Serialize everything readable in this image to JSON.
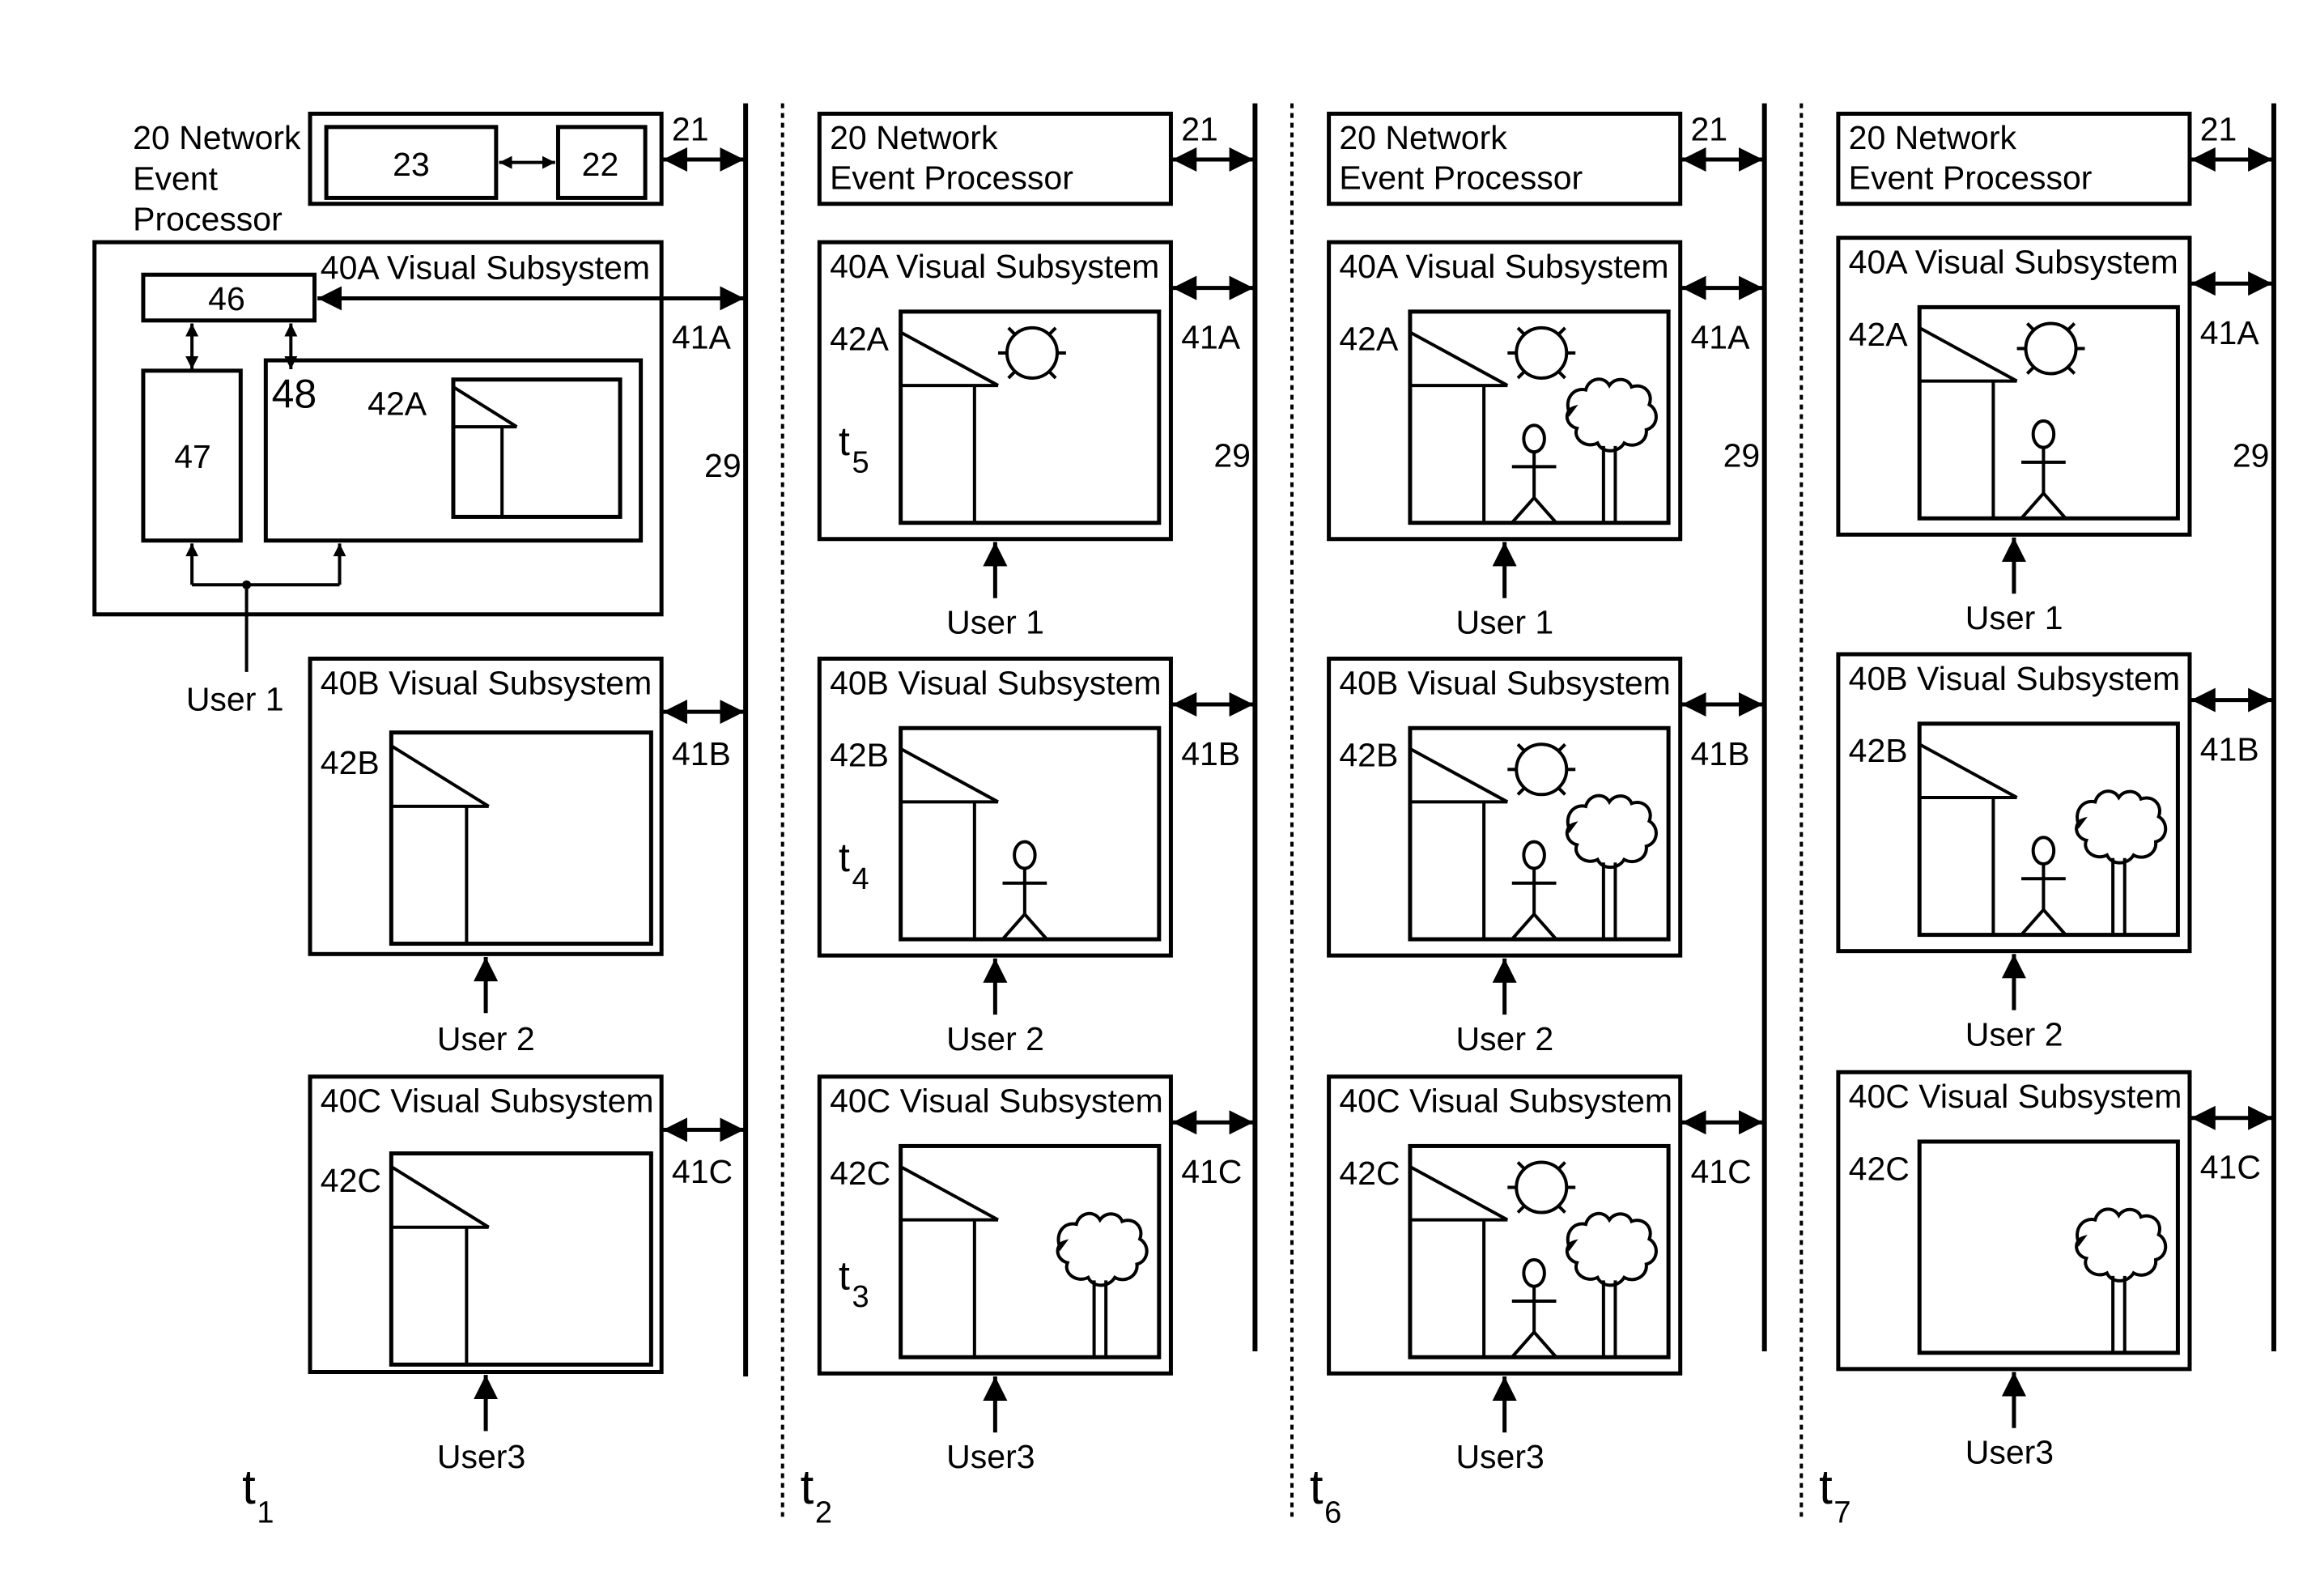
{
  "figure": {
    "colors": {
      "ink": "#000000",
      "paper": "#ffffff"
    },
    "bus_label": "29",
    "nep_link_label": "21",
    "panel1": {
      "time_label": "t",
      "time_sub": "1",
      "nep_title_lines": [
        "20 Network",
        "Event",
        "Processor"
      ],
      "nep_blocks": [
        "23",
        "22"
      ],
      "subsystem_a": {
        "title": "40A Visual Subsystem",
        "link": "41A",
        "block_46": "46",
        "block_47": "47",
        "block_48": "48",
        "screen_label": "42A",
        "user": "User 1"
      }
    },
    "panels": [
      {
        "id": "t1",
        "time_label": "t",
        "time_sub": "1",
        "subsystems": [
          {
            "title": "40B Visual Subsystem",
            "link": "41B",
            "screen_label": "42B",
            "user": "User 2",
            "contents": [
              "house"
            ],
            "inner_time": null
          },
          {
            "title": "40C Visual Subsystem",
            "link": "41C",
            "screen_label": "42C",
            "user": "User3",
            "contents": [
              "house"
            ],
            "inner_time": null
          }
        ]
      },
      {
        "id": "t2",
        "time_label": "t",
        "time_sub": "2",
        "nep_title_lines": [
          "20 Network",
          "Event Processor"
        ],
        "subsystems": [
          {
            "title": "40A Visual Subsystem",
            "link": "41A",
            "screen_label": "42A",
            "user": "User 1",
            "contents": [
              "house",
              "sun"
            ],
            "inner_time": {
              "t": "t",
              "sub": "5"
            }
          },
          {
            "title": "40B Visual Subsystem",
            "link": "41B",
            "screen_label": "42B",
            "user": "User 2",
            "contents": [
              "house",
              "person"
            ],
            "inner_time": {
              "t": "t",
              "sub": "4"
            }
          },
          {
            "title": "40C Visual Subsystem",
            "link": "41C",
            "screen_label": "42C",
            "user": "User3",
            "contents": [
              "house",
              "tree"
            ],
            "inner_time": {
              "t": "t",
              "sub": "3"
            }
          }
        ]
      },
      {
        "id": "t6",
        "time_label": "t",
        "time_sub": "6",
        "nep_title_lines": [
          "20 Network",
          "Event Processor"
        ],
        "subsystems": [
          {
            "title": "40A Visual Subsystem",
            "link": "41A",
            "screen_label": "42A",
            "user": "User 1",
            "contents": [
              "house",
              "sun",
              "person",
              "tree"
            ],
            "inner_time": null
          },
          {
            "title": "40B Visual Subsystem",
            "link": "41B",
            "screen_label": "42B",
            "user": "User 2",
            "contents": [
              "house",
              "sun",
              "person",
              "tree"
            ],
            "inner_time": null
          },
          {
            "title": "40C Visual Subsystem",
            "link": "41C",
            "screen_label": "42C",
            "user": "User3",
            "contents": [
              "house",
              "sun",
              "person",
              "tree"
            ],
            "inner_time": null
          }
        ]
      },
      {
        "id": "t7",
        "time_label": "t",
        "time_sub": "7",
        "nep_title_lines": [
          "20 Network",
          "Event Processor"
        ],
        "subsystems": [
          {
            "title": "40A Visual Subsystem",
            "link": "41A",
            "screen_label": "42A",
            "user": "User 1",
            "contents": [
              "house",
              "sun",
              "person"
            ],
            "inner_time": null
          },
          {
            "title": "40B Visual Subsystem",
            "link": "41B",
            "screen_label": "42B",
            "user": "User 2",
            "contents": [
              "house",
              "person",
              "tree"
            ],
            "inner_time": null
          },
          {
            "title": "40C Visual Subsystem",
            "link": "41C",
            "screen_label": "42C",
            "user": "User3",
            "contents": [
              "tree"
            ],
            "inner_time": null
          }
        ]
      }
    ]
  }
}
